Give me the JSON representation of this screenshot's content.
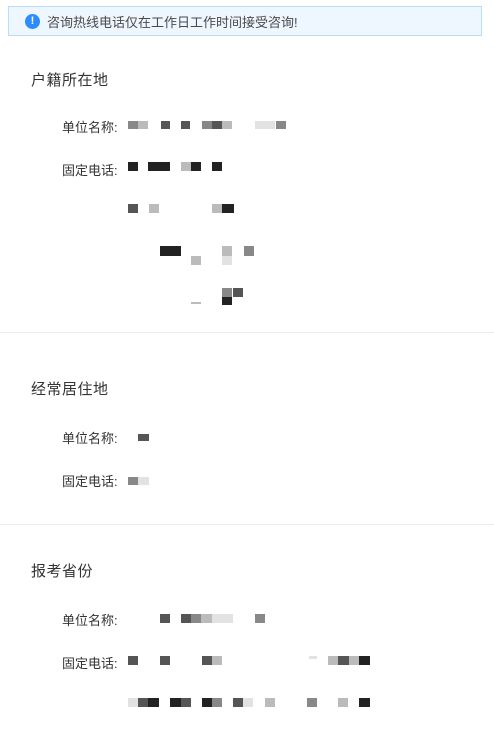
{
  "notice": {
    "icon": "info-icon",
    "text": "咨询热线电话仅在工作日工作时间接受咨询!"
  },
  "sections": [
    {
      "title": "户籍所在地",
      "unit_label": "单位名称:",
      "phone_label": "固定电话:"
    },
    {
      "title": "经常居住地",
      "unit_label": "单位名称:",
      "phone_label": "固定电话:"
    },
    {
      "title": "报考省份",
      "unit_label": "单位名称:",
      "phone_label": "固定电话:"
    }
  ],
  "colors": {
    "notice_border": "#b9dcfb",
    "notice_bg": "#eef6ff",
    "accent": "#2f8cff",
    "divider": "#ececec"
  }
}
